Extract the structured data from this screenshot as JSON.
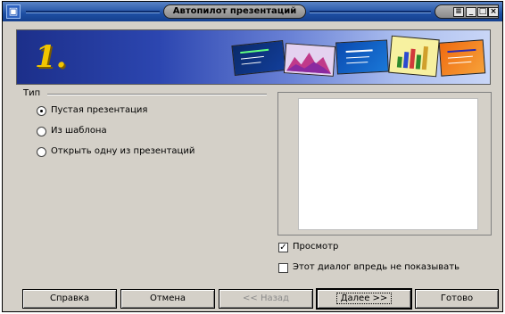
{
  "window": {
    "title": "Автопилот презентаций",
    "app_icon": "presentation-app-icon",
    "title_buttons": [
      "minimize",
      "maximize",
      "restore",
      "close"
    ]
  },
  "banner": {
    "step_number": "1."
  },
  "type_group": {
    "label": "Тип",
    "options": [
      {
        "label": "Пустая презентация",
        "selected": true
      },
      {
        "label": "Из шаблона",
        "selected": false
      },
      {
        "label": "Открыть одну из презентаций",
        "selected": false
      }
    ]
  },
  "checkboxes": {
    "preview": {
      "label": "Просмотр",
      "checked": true
    },
    "dont_show": {
      "label": "Этот диалог впредь не показывать",
      "checked": false
    }
  },
  "buttons": {
    "help": "Справка",
    "cancel": "Отмена",
    "back": "<< Назад",
    "next": "Далее >>",
    "finish": "Готово"
  }
}
